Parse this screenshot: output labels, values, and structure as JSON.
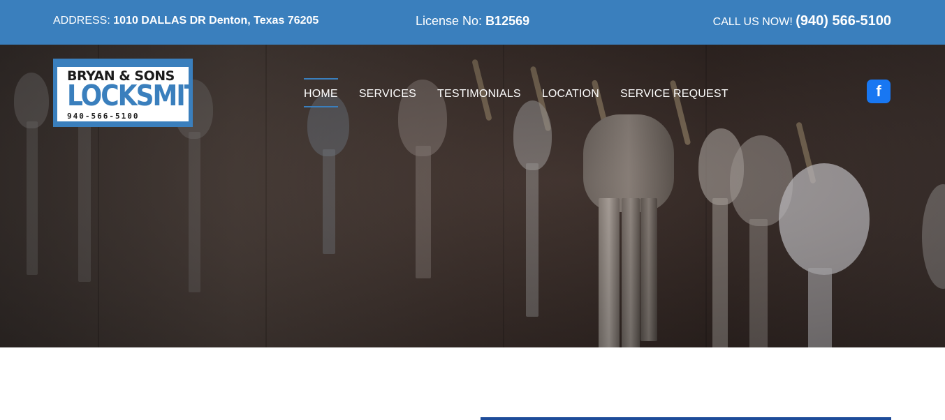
{
  "topbar": {
    "address_label": "ADDRESS: ",
    "address_value": "1010 DALLAS DR Denton, Texas 76205",
    "license_label": "License No: ",
    "license_value": "B12569",
    "call_label": "CALL US NOW! ",
    "call_phone": "(940) 566-5100"
  },
  "logo": {
    "name_line": "BRYAN & SONS",
    "brand_line": "LOCKSMITH",
    "phone_line": "940-566-5100"
  },
  "nav": {
    "items": [
      {
        "label": "HOME",
        "active": true
      },
      {
        "label": "SERVICES"
      },
      {
        "label": "TESTIMONIALS"
      },
      {
        "label": "LOCATION"
      },
      {
        "label": "SERVICE REQUEST"
      }
    ]
  },
  "social": {
    "facebook_icon": "facebook-icon",
    "facebook_glyph": "f"
  },
  "colors": {
    "accent": "#3a7fbd",
    "facebook": "#1877f2",
    "content_rule": "#1e4c9a"
  }
}
